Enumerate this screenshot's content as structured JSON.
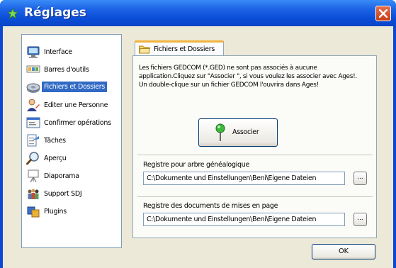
{
  "window": {
    "title": "Réglages"
  },
  "sidebar": {
    "items": [
      {
        "label": "Interface",
        "icon": "computer-icon"
      },
      {
        "label": "Barres d'outils",
        "icon": "toolbar-icon"
      },
      {
        "label": "Fichiers et Dossiers",
        "icon": "hard-disk-icon",
        "selected": true
      },
      {
        "label": "Editer une Personne",
        "icon": "person-edit-icon"
      },
      {
        "label": "Confirmer opérations",
        "icon": "dialog-icon"
      },
      {
        "label": "Tâches",
        "icon": "task-icon"
      },
      {
        "label": "Aperçu",
        "icon": "magnifier-icon"
      },
      {
        "label": "Diaporama",
        "icon": "projector-icon"
      },
      {
        "label": "Support SDJ",
        "icon": "people-icon"
      },
      {
        "label": "Plugins",
        "icon": "plugin-icon"
      }
    ]
  },
  "tab": {
    "label": "Fichiers et Dossiers",
    "icon": "folder-icon"
  },
  "panel": {
    "info_text": "Les fichiers GEDCOM (*.GED) ne sont pas associés à aucune application.Cliquez sur \"Associer \", si vous voulez les associer avec Ages!. Un double-clique sur un fichier GEDCOM l'ouvrira dans Ages!",
    "associate_label": "Associer",
    "registry_tree_label": "Registre pour arbre généalogique",
    "registry_tree_path": "C:\\Dokumente und Einstellungen\\Beni\\Eigene Dateien",
    "registry_docs_label": "Registre des documents de mises en page",
    "registry_docs_path": "C:\\Dokumente und Einstellungen\\Beni\\Eigene Dateien",
    "browse_label": "..."
  },
  "footer": {
    "ok_label": "OK"
  },
  "colors": {
    "titlebar": "#0a4ed8",
    "selection": "#316ac5",
    "tab_accent": "#f2b33e",
    "close": "#c63e18"
  }
}
